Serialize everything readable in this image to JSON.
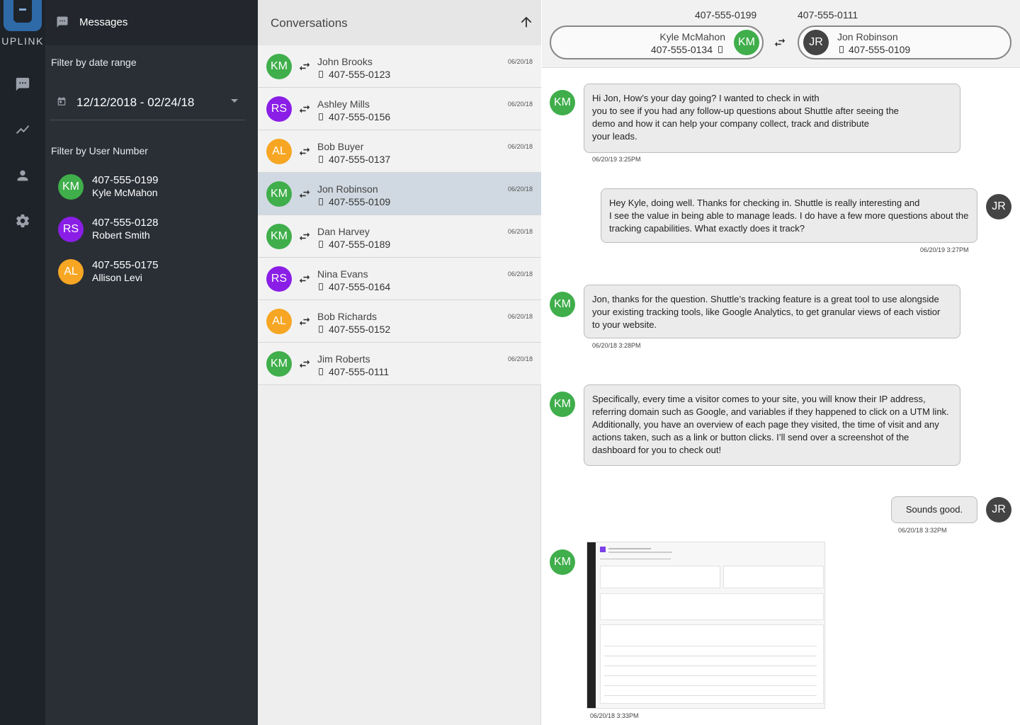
{
  "app": {
    "logo_text": "UPLINK"
  },
  "sidebar": {
    "title": "Messages",
    "date_filter_label": "Filter by date range",
    "date_range": "12/12/2018 - 02/24/18",
    "user_filter_label": "Filter by User Number",
    "users": [
      {
        "initials": "KM",
        "number": "407-555-0199",
        "name": "Kyle McMahon",
        "color": "#3fae4b"
      },
      {
        "initials": "RS",
        "number": "407-555-0128",
        "name": "Robert Smith",
        "color": "#8a1ee6"
      },
      {
        "initials": "AL",
        "number": "407-555-0175",
        "name": "Allison Levi",
        "color": "#f6a623"
      }
    ]
  },
  "conversations": {
    "title": "Conversations",
    "items": [
      {
        "initials": "KM",
        "name": "John Brooks",
        "phone": "407-555-0123",
        "date": "06/20/18"
      },
      {
        "initials": "RS",
        "name": "Ashley Mills",
        "phone": "407-555-0156",
        "date": "06/20/18"
      },
      {
        "initials": "AL",
        "name": "Bob Buyer",
        "phone": "407-555-0137",
        "date": "06/20/18"
      },
      {
        "initials": "KM",
        "name": "Jon Robinson",
        "phone": "407-555-0109",
        "date": "06/20/18"
      },
      {
        "initials": "KM",
        "name": "Dan Harvey",
        "phone": "407-555-0189",
        "date": "06/20/18"
      },
      {
        "initials": "RS",
        "name": "Nina Evans",
        "phone": "407-555-0164",
        "date": "06/20/18"
      },
      {
        "initials": "AL",
        "name": "Bob Richards",
        "phone": "407-555-0152",
        "date": "06/20/18"
      },
      {
        "initials": "KM",
        "name": "Jim Roberts",
        "phone": "407-555-0111",
        "date": "06/20/18"
      }
    ]
  },
  "chat": {
    "left_number": "407-555-0199",
    "right_number": "407-555-0111",
    "left_party": {
      "initials": "KM",
      "name": "Kyle McMahon",
      "phone": "407-555-0134"
    },
    "right_party": {
      "initials": "JR",
      "name": "Jon Robinson",
      "phone": "407-555-0109"
    },
    "messages": [
      {
        "from": "KM",
        "lines": [
          "Hi Jon, How’s your day going? I wanted to check in with",
          "you to see if you had any follow-up questions about Shuttle after seeing the",
          "demo and how it can help your company collect, track and distribute",
          "your leads."
        ],
        "time": "06/20/19 3:25PM"
      },
      {
        "from": "JR",
        "lines": [
          "Hey Kyle, doing well. Thanks for checking in. Shuttle is really interesting and",
          "I see the value in being able to manage leads. I do have a few more questions about the",
          "tracking capabilities. What exactly does it track?"
        ],
        "time": "06/20/19 3:27PM"
      },
      {
        "from": "KM",
        "lines": [
          "Jon, thanks for the question. Shuttle’s tracking feature is a great tool to use alongside",
          "your existing tracking tools, like Google Analytics, to get granular views of each vistior",
          "to your website."
        ],
        "time": "06/20/18 3:28PM"
      },
      {
        "from": "KM",
        "lines": [
          "Specifically, every time a visitor comes to your site, you will know their IP address,",
          "referring domain such as Google, and variables if they happened to click on a UTM link.",
          "Additionally, you have an overview of each page they visited, the time of visit and any",
          "actions taken, such as a link or button clicks. I’ll send over a screenshot of the",
          "dashboard for you to check out!"
        ],
        "time": ""
      },
      {
        "from": "JR",
        "lines": [
          "Sounds good."
        ],
        "time": "06/20/18 3:32PM"
      },
      {
        "from": "KM",
        "lines": [],
        "time": "06/20/18 3:33PM"
      }
    ]
  }
}
